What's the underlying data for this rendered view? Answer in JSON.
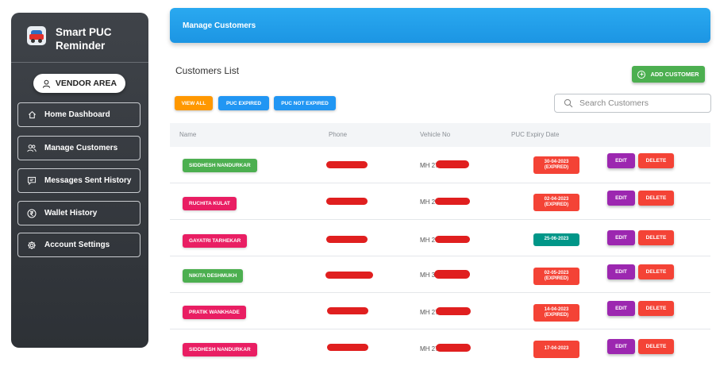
{
  "brand": {
    "line1": "Smart PUC",
    "line2": "Reminder",
    "icon": "car-icon"
  },
  "sidebar": {
    "vendor_label": "VENDOR AREA",
    "items": [
      {
        "label": "Home Dashboard",
        "icon": "home-icon"
      },
      {
        "label": "Manage Customers",
        "icon": "users-icon"
      },
      {
        "label": "Messages Sent History",
        "icon": "message-icon"
      },
      {
        "label": "Wallet History",
        "icon": "rupee-icon"
      },
      {
        "label": "Account Settings",
        "icon": "gear-icon"
      }
    ]
  },
  "header": {
    "title": "Manage Customers"
  },
  "main": {
    "list_title": "Customers List",
    "add_button": "ADD CUSTOMER",
    "filters": [
      "VIEW ALL",
      "PUC EXPIRED",
      "PUC NOT EXPIRED"
    ],
    "search_placeholder": "Search Customers"
  },
  "table": {
    "columns": [
      "Name",
      "Phone",
      "Vehicle No",
      "PUC Expiry Date"
    ],
    "edit_label": "EDIT",
    "delete_label": "DELETE",
    "rows": [
      {
        "name": "SIDDHESH NANDURKAR",
        "vehicle_prefix": "MH 27",
        "expiry_date": "30-04-2023",
        "expiry_status": "(EXPIRED)"
      },
      {
        "name": "RUCHITA KULAT",
        "vehicle_prefix": "MH 27",
        "expiry_date": "02-04-2023",
        "expiry_status": "(EXPIRED)"
      },
      {
        "name": "GAYATRI TARHEKAR",
        "vehicle_prefix": "MH 27",
        "expiry_date": "25-06-2023",
        "expiry_status": ""
      },
      {
        "name": "NIKITA DESHMUKH",
        "vehicle_prefix": "MH 37",
        "expiry_date": "02-05-2023",
        "expiry_status": "(EXPIRED)"
      },
      {
        "name": "PRATIK WANKHADE",
        "vehicle_prefix": "MH 27",
        "expiry_date": "14-04-2023",
        "expiry_status": "(EXPIRED)"
      },
      {
        "name": "SIDDHESH NANDURKAR",
        "vehicle_prefix": "MH 27",
        "expiry_date": "17-04-2023",
        "expiry_status": ""
      }
    ]
  },
  "colors": {
    "header": "#1c95e3",
    "sidebar": "#33373c",
    "green": "#4caf50",
    "pink": "#e91e63",
    "red": "#f44336",
    "purple": "#9c27b0",
    "teal": "#009688",
    "orange": "#ff9800",
    "blue": "#2196f3"
  }
}
